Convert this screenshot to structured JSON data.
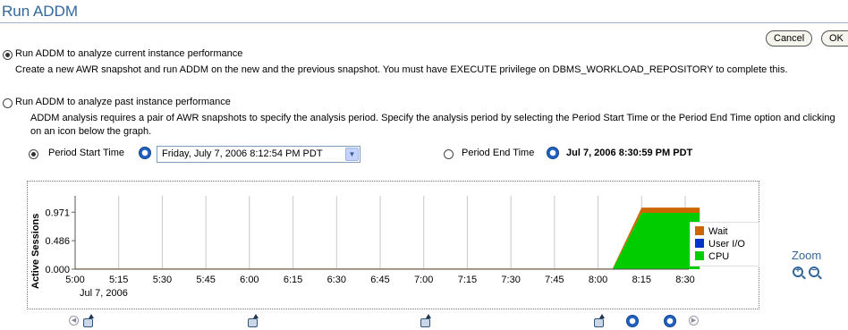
{
  "page": {
    "title": "Run ADDM"
  },
  "actions": {
    "cancel_label": "Cancel",
    "ok_label": "OK"
  },
  "options": {
    "current": {
      "label": "Run ADDM to analyze current instance performance",
      "description": "Create a new AWR snapshot and run ADDM on the new and the previous snapshot. You must have EXECUTE privilege on DBMS_WORKLOAD_REPOSITORY to complete this.",
      "selected": true
    },
    "past": {
      "label": "Run ADDM to analyze past instance performance",
      "description": "ADDM analysis requires a pair of AWR snapshots to specify the analysis period. Specify the analysis period by selecting the Period Start Time or the Period End Time option and clicking on an icon below the graph.",
      "selected": false
    }
  },
  "period": {
    "start_label": "Period Start Time",
    "start_value": "Friday, July 7, 2006 8:12:54 PM PDT",
    "start_selected": true,
    "end_label": "Period End Time",
    "end_value": "Jul 7, 2006 8:30:59 PM PDT",
    "end_selected": false
  },
  "chart_data": {
    "type": "area",
    "ylabel": "Active Sessions",
    "x_tick_labels": [
      "5:00",
      "5:15",
      "5:30",
      "5:45",
      "6:00",
      "6:15",
      "6:30",
      "6:45",
      "7:00",
      "7:15",
      "7:30",
      "7:45",
      "8:00",
      "8:15",
      "8:30"
    ],
    "x_date_label": "Jul 7, 2006",
    "y_tick_labels": [
      "0.000",
      "0.486",
      "0.971"
    ],
    "ylim": [
      0,
      1.25
    ],
    "x": [
      "5:00",
      "8:05",
      "8:15",
      "8:35"
    ],
    "stacked": true,
    "series": [
      {
        "name": "CPU",
        "color": "#00cc00",
        "values": [
          0.0,
          0.0,
          0.96,
          0.96
        ]
      },
      {
        "name": "User I/O",
        "color": "#0033cc",
        "values": [
          0.0,
          0.0,
          0.0,
          0.0
        ]
      },
      {
        "name": "Wait",
        "color": "#cc6600",
        "values": [
          0.012,
          0.012,
          0.09,
          0.09
        ]
      }
    ],
    "legend_position": "right",
    "grid": true
  },
  "zoom": {
    "label": "Zoom",
    "in_icon": "zoom-in-icon",
    "out_icon": "zoom-out-icon"
  }
}
